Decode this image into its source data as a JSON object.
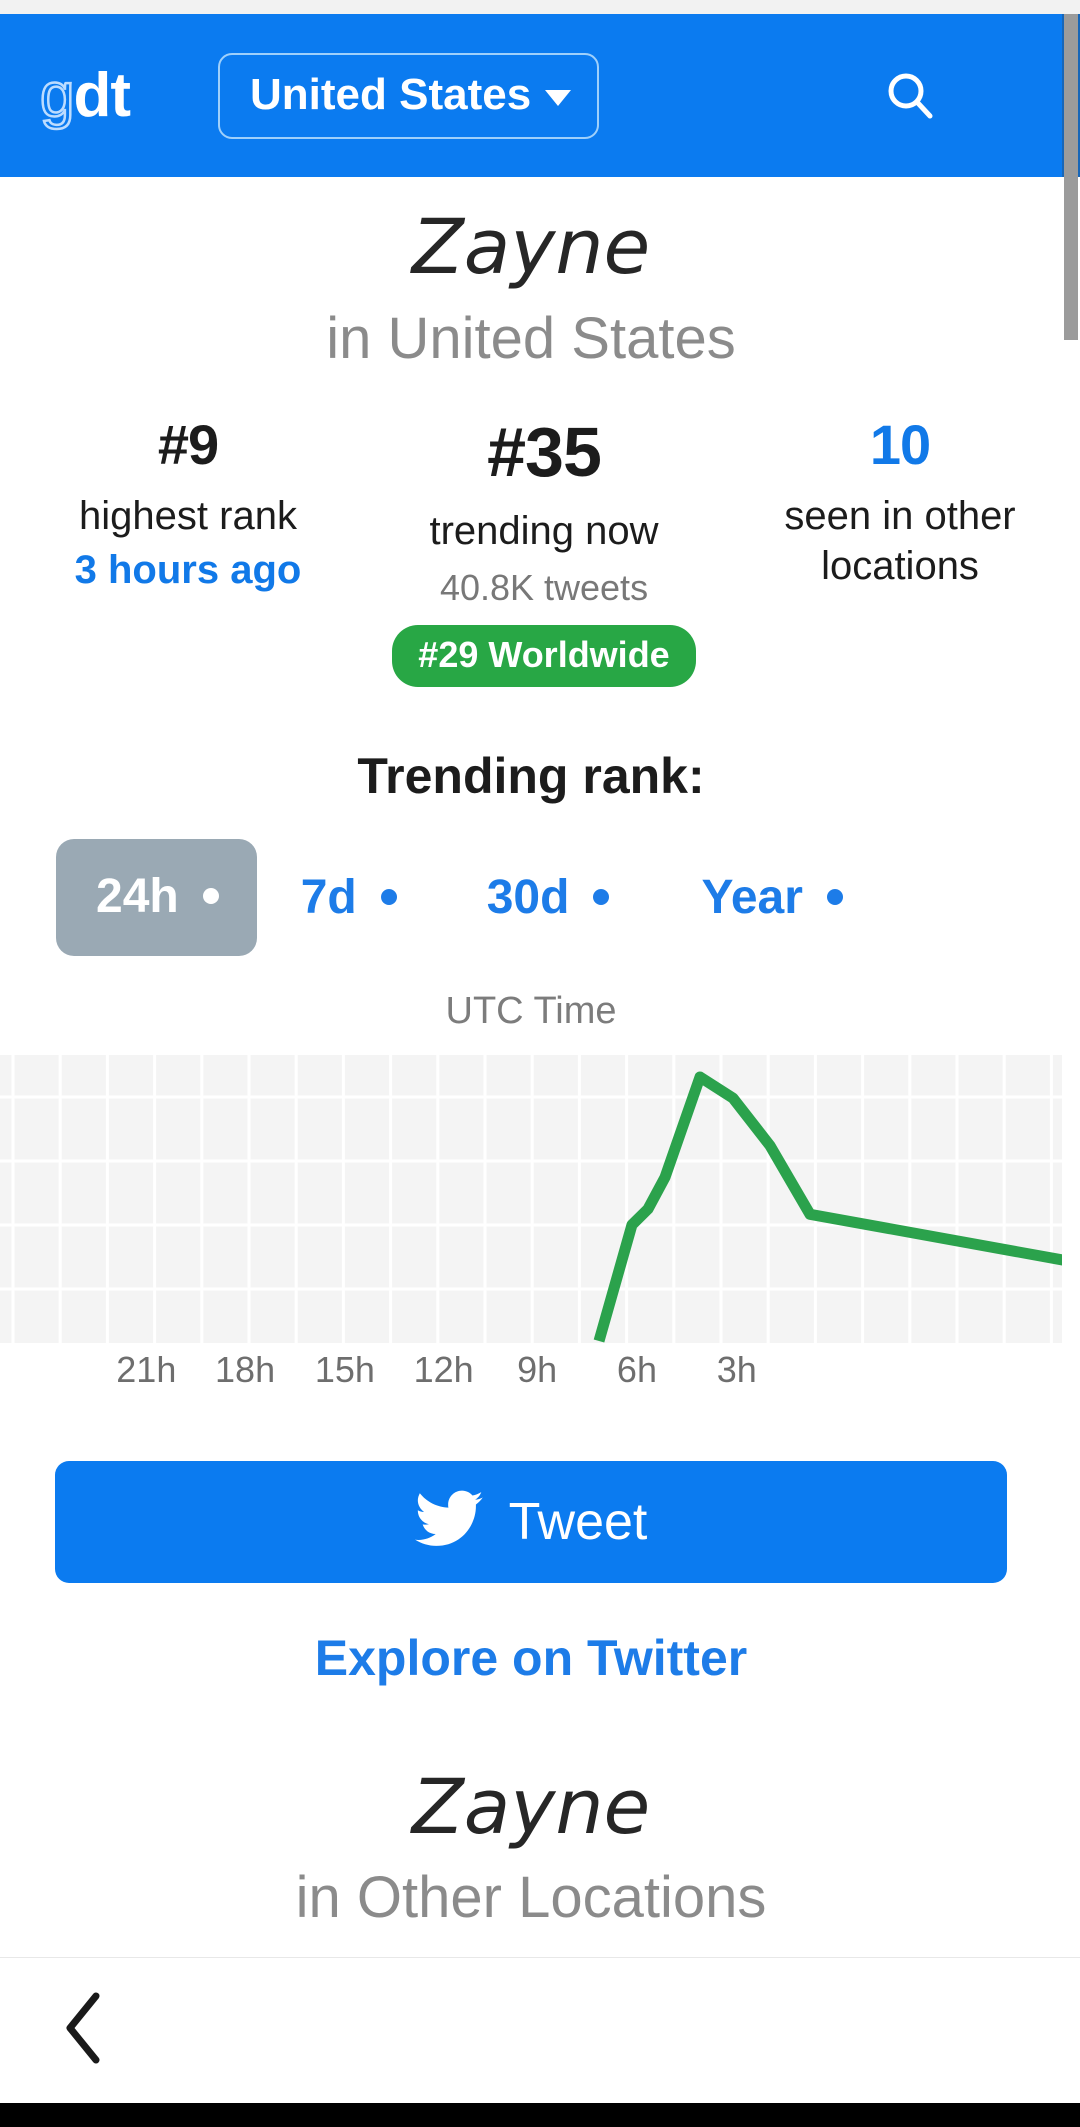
{
  "header": {
    "logo_text_light": "g",
    "logo_text_bold": "dt",
    "location_label": "United States",
    "search_icon": "search-icon",
    "menu_icon": "hamburger-menu-icon"
  },
  "main": {
    "title": "Zayne",
    "subtitle": "in United States",
    "stats": {
      "highest_rank": {
        "value": "#9",
        "label": "highest rank",
        "sub": "3 hours ago"
      },
      "trending_now": {
        "value": "#35",
        "label": "trending now",
        "tweets": "40.8K tweets",
        "badge": "#29 Worldwide"
      },
      "other_locations": {
        "value": "10",
        "label": "seen in other locations"
      }
    },
    "rank_heading": "Trending rank:",
    "tabs": [
      {
        "label": "24h",
        "active": true
      },
      {
        "label": "7d",
        "active": false
      },
      {
        "label": "30d",
        "active": false
      },
      {
        "label": "Year",
        "active": false
      }
    ],
    "timezone_label": "UTC Time",
    "tweet_button": "Tweet",
    "twitter_icon": "twitter-bird-icon",
    "explore_link": "Explore on Twitter",
    "section2_title": "Zayne",
    "section2_subtitle": "in Other Locations"
  },
  "navbar": {
    "back_icon": "back-chevron-icon"
  },
  "colors": {
    "brand_blue": "#0b7bf0",
    "link_blue": "#1d7ce8",
    "badge_green": "#28a745",
    "series_green": "#2ba24c",
    "active_tab_gray": "#9aa9b4",
    "muted_gray": "#8b8b8b",
    "chart_bg": "#f4f4f4"
  },
  "chart_data": {
    "type": "line",
    "title": "Trending rank:",
    "subtitle": "UTC Time",
    "xlabel": "",
    "ylabel": "",
    "grid": true,
    "legend": false,
    "categories": [
      "21h",
      "18h",
      "15h",
      "12h",
      "9h",
      "6h",
      "3h"
    ],
    "tick_positions_pct": [
      10.2,
      19.5,
      28.9,
      38.2,
      47.0,
      56.4,
      65.8
    ],
    "series": [
      {
        "name": "Trending rank",
        "color": "#2ba24c",
        "points": [
          {
            "x": "6h",
            "y": 0
          },
          {
            "x": "5h",
            "y": 44
          },
          {
            "x": "4.5h",
            "y": 50
          },
          {
            "x": "4h",
            "y": 62
          },
          {
            "x": "3.5h",
            "y": 100
          },
          {
            "x": "3h",
            "y": 92
          },
          {
            "x": "2h",
            "y": 74
          },
          {
            "x": "1h",
            "y": 48
          }
        ]
      }
    ],
    "ylim": [
      0,
      100
    ],
    "note": "Line begins at the 6h tick, rises steeply, plateaus briefly, peaks just before the 3h tick, then declines toward the right edge."
  }
}
